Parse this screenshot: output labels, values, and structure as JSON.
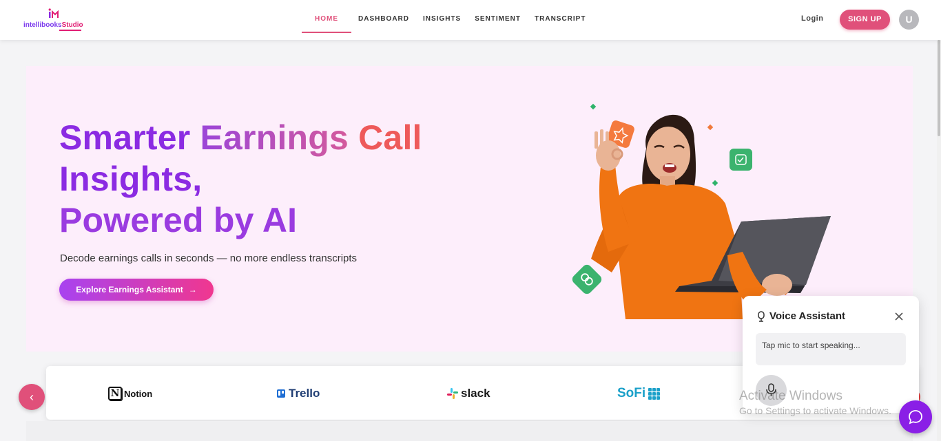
{
  "header": {
    "logo_text_a": "intellibooks",
    "logo_text_b": "Studio",
    "nav": [
      "HOME",
      "DASHBOARD",
      "INSIGHTS",
      "SENTIMENT",
      "TRANSCRIPT"
    ],
    "active_nav": "HOME",
    "login_label": "Login",
    "signup_label": "SIGN UP",
    "avatar_initial": "U"
  },
  "hero": {
    "title_line1_a": "Smarter",
    "title_line1_b": "Earnings",
    "title_line1_c": "Call",
    "title_line2": "Insights,",
    "title_line3": "Powered by AI",
    "subtitle": "Decode earnings calls in seconds — no more endless transcripts",
    "cta_label": "Explore Earnings Assistant",
    "cta_arrow": "→"
  },
  "logos": {
    "notion_mark": "N",
    "notion": "Notion",
    "trello": "Trello",
    "slack": "slack",
    "sofi": "SoFi"
  },
  "carousel": {
    "prev_glyph": "‹"
  },
  "voice_assistant": {
    "title": "Voice Assistant",
    "prompt": "Tap mic to start speaking..."
  },
  "watermark": {
    "title": "Activate Windows",
    "subtitle": "Go to Settings to activate Windows."
  },
  "colors": {
    "accent_pink": "#e0507a",
    "hero_bg": "#fdeefb",
    "title_purple": "#8b2be2",
    "title_coral": "#ee5a5a",
    "chat_fab": "#8a1fe6"
  }
}
